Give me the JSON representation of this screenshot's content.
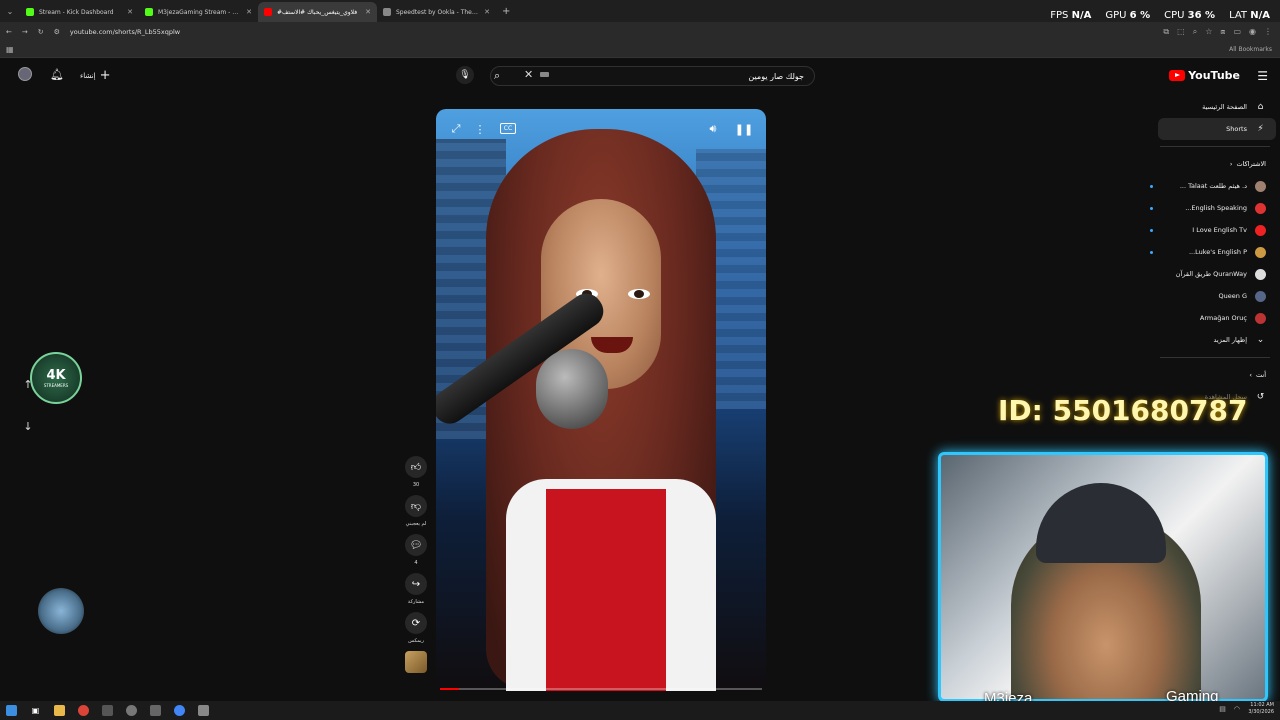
{
  "browser": {
    "tabs": [
      {
        "label": "Stream - Kick Dashboard",
        "color": "#53fc18",
        "active": false
      },
      {
        "label": "M3jezaGaming Stream - Watch",
        "color": "#53fc18",
        "active": false
      },
      {
        "label": "#فلاوي_يتيغس_يحباك #الاستف",
        "color": "#ff0000",
        "active": true
      },
      {
        "label": "Speedtest by Ookla - The Glob",
        "color": "#888888",
        "active": false
      }
    ],
    "url": "youtube.com/shorts/R_Lb55xqplw",
    "bookmarks_label": "All Bookmarks"
  },
  "hud": {
    "fps_label": "FPS",
    "fps_value": "N/A",
    "gpu_label": "GPU",
    "gpu_value": "6 %",
    "cpu_label": "CPU",
    "cpu_value": "36 %",
    "lat_label": "LAT",
    "lat_value": "N/A"
  },
  "youtube": {
    "logo_text": "YouTube",
    "search_query": "جولك صار يومين",
    "create_label": "إنشاء"
  },
  "sidebar": {
    "home": "الصفحة الرئيسية",
    "shorts": "Shorts",
    "subscriptions_title": "الاشتراكات",
    "channels": [
      {
        "name": "د. هيثم طلعت Talaat ...",
        "color": "#a08070",
        "dot": true
      },
      {
        "name": "English Speaking...",
        "color": "#d33",
        "dot": true
      },
      {
        "name": "I Love English Tv",
        "color": "#e22",
        "dot": true
      },
      {
        "name": "Luke's English P...",
        "color": "#c94",
        "dot": true
      },
      {
        "name": "QuranWay طريق القرآن",
        "color": "#ddd",
        "dot": false
      },
      {
        "name": "Queen G",
        "color": "#568",
        "dot": false
      },
      {
        "name": "Armağan Oruç",
        "color": "#b33",
        "dot": false
      }
    ],
    "show_more": "إظهار المزيد",
    "you_title": "أنت",
    "history_label": "سجل المشاهدة"
  },
  "video": {
    "progress_percent": 6
  },
  "actions": {
    "like_count": "30",
    "dislike_label": "لم يعجبني",
    "comments_count": "4",
    "share_label": "مشاركة",
    "remix_label": "ريمكس"
  },
  "overlay": {
    "logo_text": "4K",
    "logo_sub": "STREAMERS",
    "id_text": "ID: 5501680787",
    "cam_name": "M3jeza",
    "cam_tag": "Gaming"
  },
  "taskbar": {
    "time": "11:02 AM",
    "date": "3/30/2026"
  }
}
